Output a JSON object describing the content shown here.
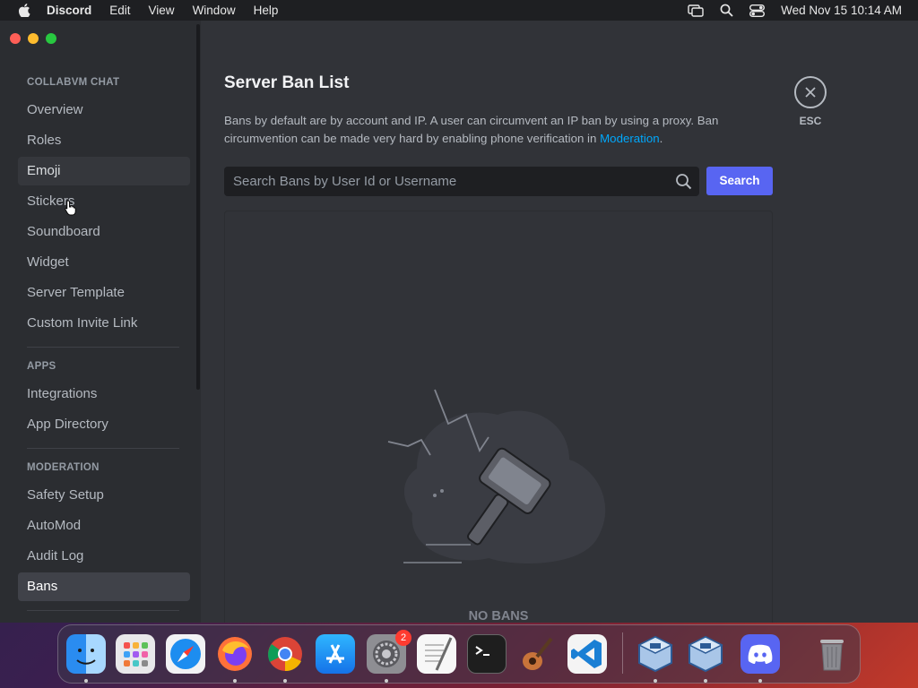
{
  "menubar": {
    "app_name": "Discord",
    "items": [
      "Edit",
      "View",
      "Window",
      "Help"
    ],
    "datetime": "Wed Nov 15  10:14 AM"
  },
  "sidebar": {
    "sections": [
      {
        "header": "COLLABVM CHAT",
        "items": [
          "Overview",
          "Roles",
          "Emoji",
          "Stickers",
          "Soundboard",
          "Widget",
          "Server Template",
          "Custom Invite Link"
        ]
      },
      {
        "header": "APPS",
        "items": [
          "Integrations",
          "App Directory"
        ]
      },
      {
        "header": "MODERATION",
        "items": [
          "Safety Setup",
          "AutoMod",
          "Audit Log",
          "Bans"
        ]
      }
    ],
    "hovered_item": "Emoji",
    "active_item": "Bans"
  },
  "main": {
    "title": "Server Ban List",
    "description": "Bans by default are by account and IP. A user can circumvent an IP ban by using a proxy. Ban circumvention can be made very hard by enabling phone verification in ",
    "description_link": "Moderation",
    "description_end": ".",
    "search_placeholder": "Search Bans by User Id or Username",
    "search_value": "",
    "search_button": "Search",
    "empty_state": "NO BANS",
    "close_label": "ESC"
  },
  "dock": {
    "apps": [
      "Finder",
      "Launchpad",
      "Safari",
      "Firefox",
      "Chrome",
      "App Store",
      "System Settings",
      "TextEdit",
      "Terminal",
      "GarageBand",
      "Visual Studio Code",
      "VirtualBox",
      "VirtualBox",
      "Discord",
      "Trash"
    ],
    "system_settings_badge": "2"
  },
  "colors": {
    "accent": "#5865f2",
    "link": "#00a8fc",
    "sidebar_bg": "#2b2d31",
    "content_bg": "#313338"
  }
}
